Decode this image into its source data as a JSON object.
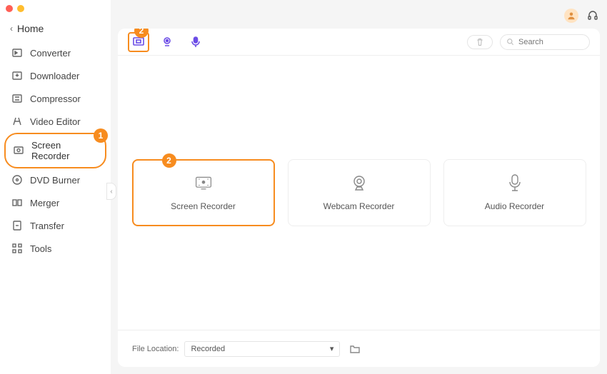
{
  "sidebar": {
    "home_label": "Home",
    "items": [
      {
        "label": "Converter"
      },
      {
        "label": "Downloader"
      },
      {
        "label": "Compressor"
      },
      {
        "label": "Video Editor"
      },
      {
        "label": "Screen Recorder"
      },
      {
        "label": "DVD Burner"
      },
      {
        "label": "Merger"
      },
      {
        "label": "Transfer"
      },
      {
        "label": "Tools"
      }
    ]
  },
  "annotations": {
    "badge1": "1",
    "badge2": "2"
  },
  "header": {
    "search_placeholder": "Search"
  },
  "cards": {
    "screen": "Screen Recorder",
    "webcam": "Webcam Recorder",
    "audio": "Audio Recorder"
  },
  "footer": {
    "label": "File Location:",
    "dropdown_value": "Recorded"
  }
}
